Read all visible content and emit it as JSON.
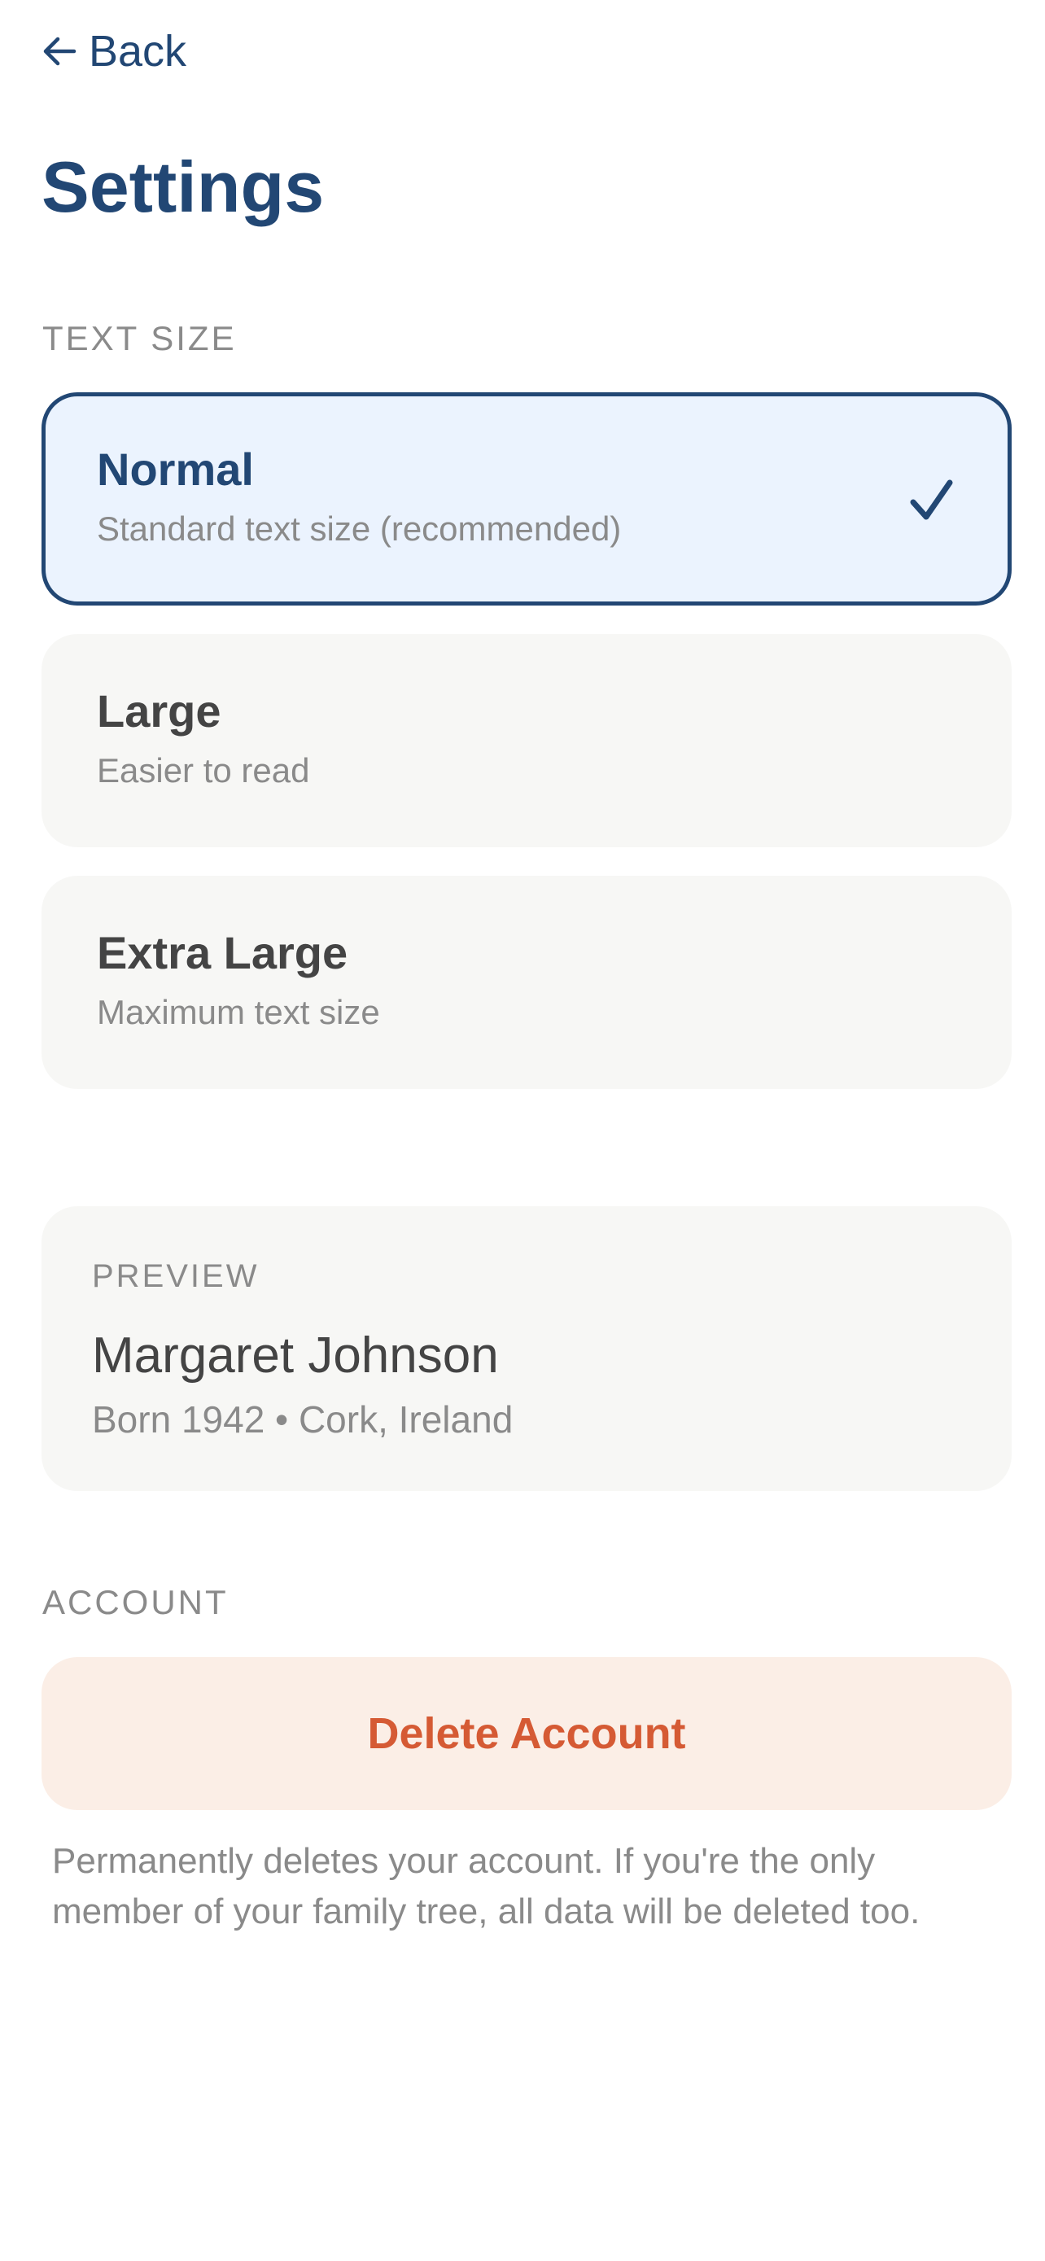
{
  "header": {
    "back_label": "Back",
    "title": "Settings"
  },
  "text_size": {
    "section_label": "TEXT SIZE",
    "selected": "Normal",
    "options": [
      {
        "title": "Normal",
        "description": "Standard text size (recommended)"
      },
      {
        "title": "Large",
        "description": "Easier to read"
      },
      {
        "title": "Extra Large",
        "description": "Maximum text size"
      }
    ]
  },
  "preview": {
    "label": "PREVIEW",
    "name": "Margaret Johnson",
    "meta": "Born 1942 • Cork, Ireland"
  },
  "account": {
    "section_label": "ACCOUNT",
    "delete_label": "Delete Account",
    "delete_note": "Permanently deletes your account. If you're the only member of your family tree, all data will be deleted too."
  },
  "colors": {
    "brand": "#224774",
    "selected_bg": "#ebf3fe",
    "card_bg": "#f7f7f5",
    "danger": "#d55a34",
    "danger_bg": "#fbeee6"
  },
  "icons": {
    "back": "arrow-left-icon",
    "selected": "checkmark-icon"
  }
}
